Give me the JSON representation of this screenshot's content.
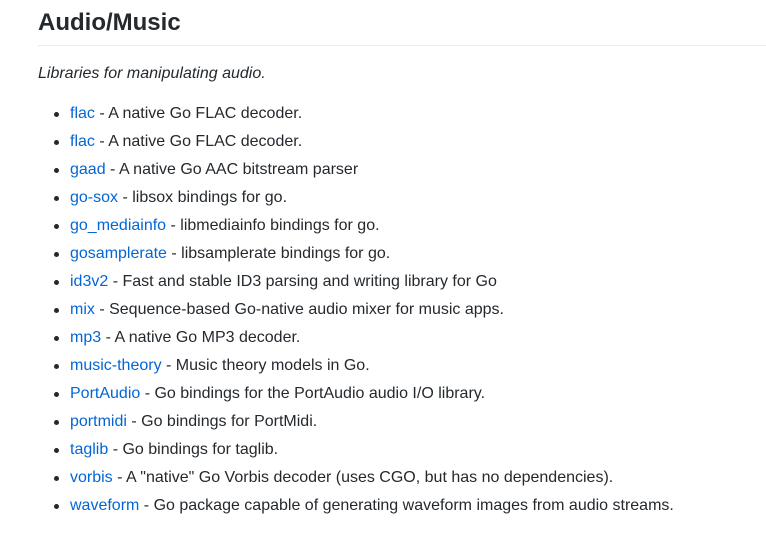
{
  "section": {
    "title": "Audio/Music",
    "description": "Libraries for manipulating audio.",
    "separator": " - ",
    "items": [
      {
        "name": "flac",
        "desc": "A native Go FLAC decoder."
      },
      {
        "name": "flac",
        "desc": "A native Go FLAC decoder."
      },
      {
        "name": "gaad",
        "desc": "A native Go AAC bitstream parser"
      },
      {
        "name": "go-sox",
        "desc": "libsox bindings for go."
      },
      {
        "name": "go_mediainfo",
        "desc": "libmediainfo bindings for go."
      },
      {
        "name": "gosamplerate",
        "desc": "libsamplerate bindings for go."
      },
      {
        "name": "id3v2",
        "desc": "Fast and stable ID3 parsing and writing library for Go"
      },
      {
        "name": "mix",
        "desc": "Sequence-based Go-native audio mixer for music apps."
      },
      {
        "name": "mp3",
        "desc": "A native Go MP3 decoder."
      },
      {
        "name": "music-theory",
        "desc": "Music theory models in Go."
      },
      {
        "name": "PortAudio",
        "desc": "Go bindings for the PortAudio audio I/O library."
      },
      {
        "name": "portmidi",
        "desc": "Go bindings for PortMidi."
      },
      {
        "name": "taglib",
        "desc": "Go bindings for taglib."
      },
      {
        "name": "vorbis",
        "desc": "A \"native\" Go Vorbis decoder (uses CGO, but has no dependencies)."
      },
      {
        "name": "waveform",
        "desc": "Go package capable of generating waveform images from audio streams."
      }
    ]
  },
  "colors": {
    "link": "#0366d6",
    "text": "#24292e",
    "rule": "#eaecef"
  }
}
